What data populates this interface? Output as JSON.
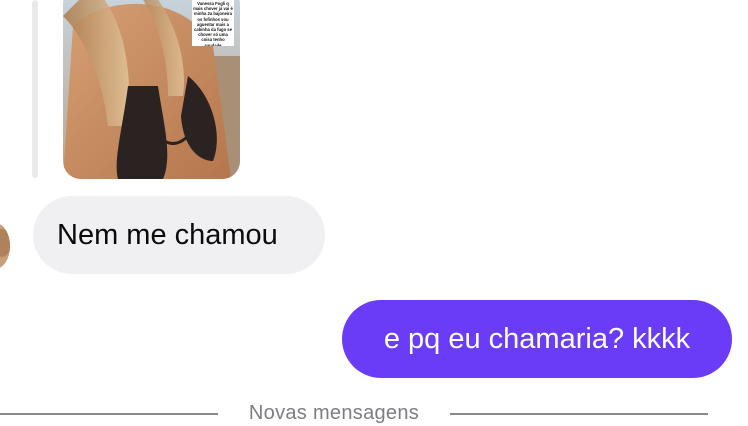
{
  "story": {
    "caption": "Vanessa Fogli q mais chover já vai é minha 2a bajoneira os fofinhos vou aguentar mais a cabinha da fugo se chover só uma coisa tenho saudade"
  },
  "messages": [
    {
      "direction": "incoming",
      "text": "Nem me chamou"
    },
    {
      "direction": "outgoing",
      "text": "e pq eu chamaria? kkkk"
    }
  ],
  "divider": {
    "label": "Novas mensagens"
  },
  "colors": {
    "incoming_bubble": "#f0f0f2",
    "outgoing_bubble": "#6a3cf8",
    "divider_line": "#8a8a8e"
  }
}
